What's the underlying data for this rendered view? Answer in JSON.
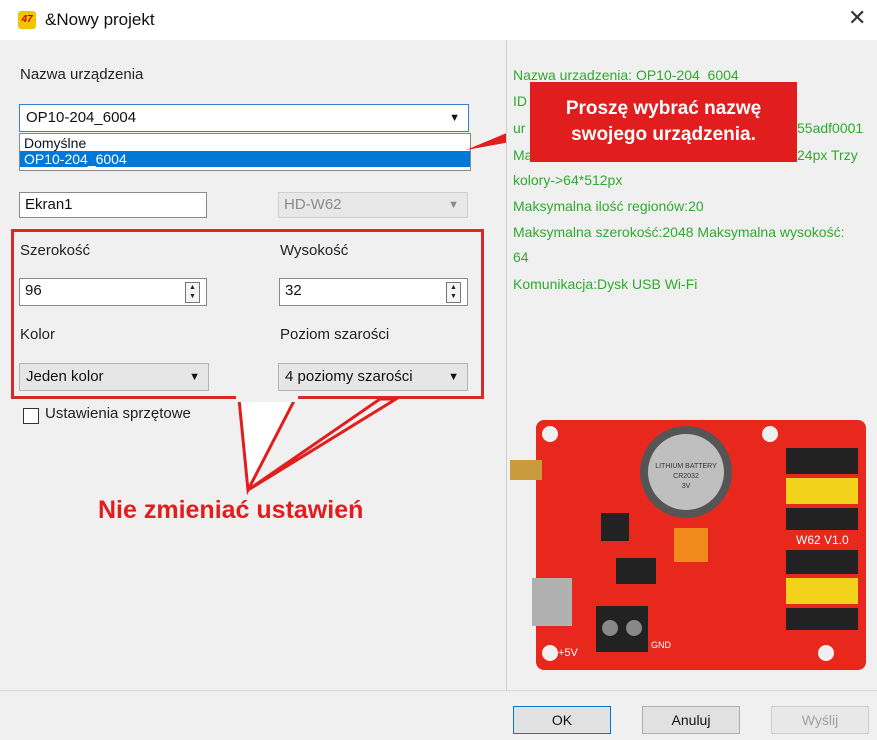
{
  "window": {
    "title": "&Nowy projekt",
    "icon_text": "47",
    "close_glyph": "✕"
  },
  "form": {
    "device_name_label": "Nazwa urządzenia",
    "device_name_value": "OP10-204_6004",
    "device_name_options": [
      "Domyślne",
      "OP10-204_6004"
    ],
    "screen_name_value": "Ekran1",
    "controller_value": "HD-W62",
    "width_label": "Szerokość",
    "width_value": "96",
    "height_label": "Wysokość",
    "height_value": "32",
    "color_label": "Kolor",
    "color_value": "Jeden kolor",
    "gray_label": "Poziom szarości",
    "gray_value": "4 poziomy szarości",
    "hardware_settings_label": "Ustawienia sprzętowe"
  },
  "info": {
    "line1": "Nazwa urzadzenia: OP10-204_6004",
    "line2": "ID",
    "line3_prefix": "ur",
    "line3_suffix": "55adf0001",
    "line4_prefix": "Ma",
    "line4_suffix": "24px Trzy",
    "line5": "kolory->64*512px",
    "line6": "Maksymalna ilość regionów:20",
    "line7": "Maksymalna szerokość:2048 Maksymalna wysokość:",
    "line8": "64",
    "line9": "Komunikacja:Dysk USB  Wi-Fi"
  },
  "annotations": {
    "callout_top": "Proszę wybrać nazwę swojego urządzenia.",
    "callout_bottom": "Nie zmieniać ustawień",
    "red_color": "#e21d1d"
  },
  "board": {
    "battery_text_1": "LITHIUM BATTERY",
    "battery_text_2": "CR2032",
    "battery_text_3": "3V",
    "model_text": "W62 V1.0",
    "power_text": "+5V",
    "gnd_text": "GND"
  },
  "buttons": {
    "ok": "OK",
    "cancel": "Anuluj",
    "send": "Wyślij"
  }
}
